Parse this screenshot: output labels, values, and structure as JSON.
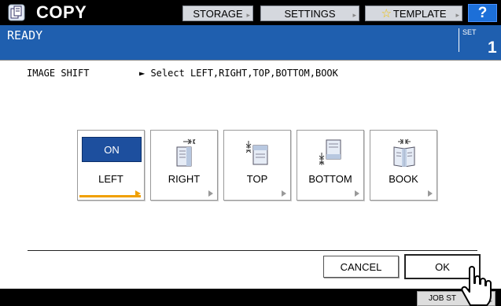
{
  "header": {
    "app_title": "COPY",
    "buttons": {
      "storage": "STORAGE",
      "settings": "SETTINGS",
      "template": "TEMPLATE",
      "help": "?"
    }
  },
  "status": {
    "text": "READY",
    "set_label": "SET",
    "set_count": "1"
  },
  "function": {
    "name": "IMAGE SHIFT",
    "instruction": "► Select LEFT,RIGHT,TOP,BOTTOM,BOOK"
  },
  "options": [
    {
      "label": "LEFT",
      "selected": true,
      "state": "ON"
    },
    {
      "label": "RIGHT",
      "selected": false
    },
    {
      "label": "TOP",
      "selected": false
    },
    {
      "label": "BOTTOM",
      "selected": false
    },
    {
      "label": "BOOK",
      "selected": false
    }
  ],
  "actions": {
    "cancel": "CANCEL",
    "ok": "OK"
  },
  "footer": {
    "job_status": "JOB ST"
  },
  "colors": {
    "status_bar": "#1f5faf",
    "selected_on": "#1d4f9e",
    "selection_accent": "#f0a000",
    "help_button": "#1c6fd8"
  },
  "icons": [
    "copy-app-icon",
    "shift-right-icon",
    "shift-top-icon",
    "shift-bottom-icon",
    "book-icon",
    "pointer-hand-icon"
  ]
}
